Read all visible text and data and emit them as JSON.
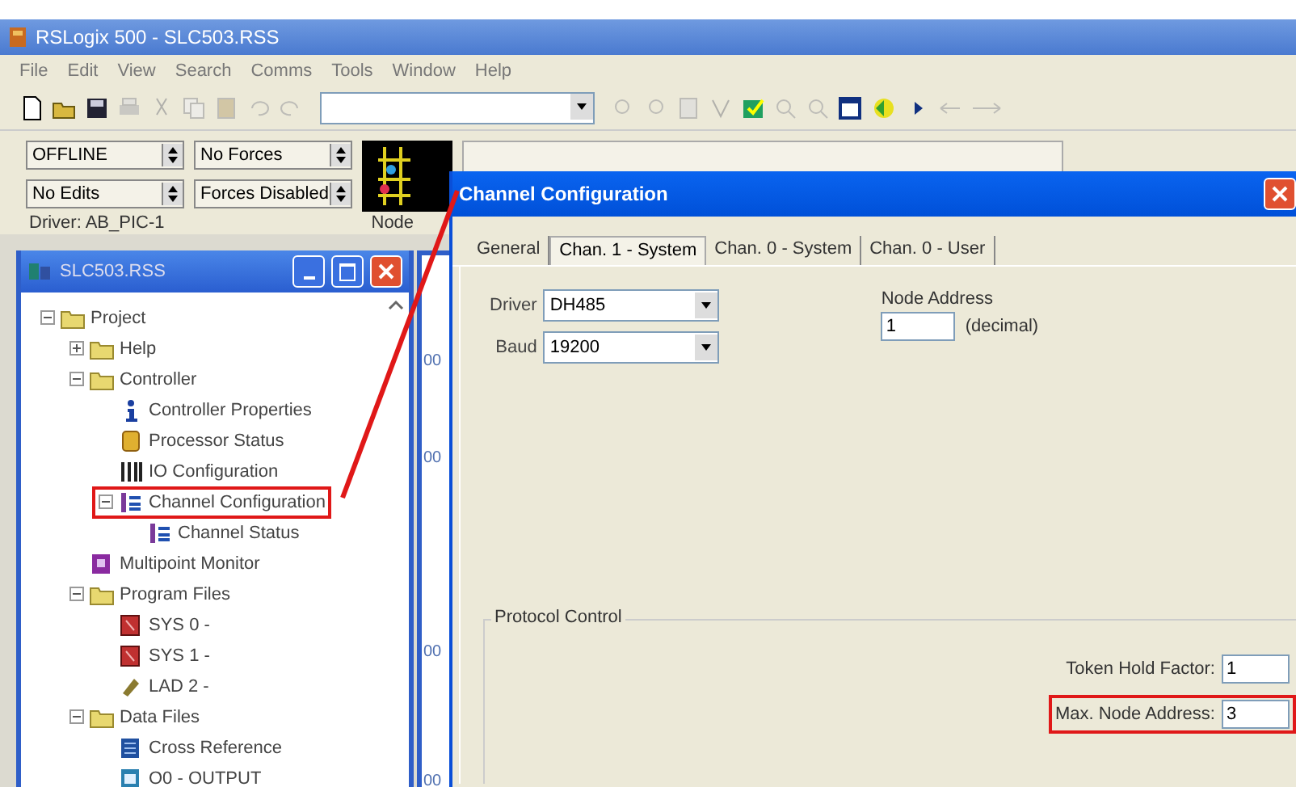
{
  "window": {
    "title": "RSLogix 500 - SLC503.RSS"
  },
  "menu": [
    "File",
    "Edit",
    "View",
    "Search",
    "Comms",
    "Tools",
    "Window",
    "Help"
  ],
  "status": {
    "mode": "OFFLINE",
    "forces": "No Forces",
    "edits": "No Edits",
    "forces_enabled": "Forces Disabled",
    "driver": "Driver: AB_PIC-1",
    "node": "Node"
  },
  "project_window": {
    "title": "SLC503.RSS",
    "tree": [
      {
        "label": "Project",
        "kind": "folder",
        "expanded": true,
        "highlighted": false,
        "children": [
          {
            "label": "Help",
            "kind": "folder",
            "expanded": false,
            "highlighted": false
          },
          {
            "label": "Controller",
            "kind": "folder",
            "expanded": true,
            "highlighted": false,
            "children": [
              {
                "label": "Controller Properties",
                "kind": "info",
                "highlighted": false
              },
              {
                "label": "Processor Status",
                "kind": "processor",
                "highlighted": false
              },
              {
                "label": "IO Configuration",
                "kind": "io",
                "highlighted": false
              },
              {
                "label": "Channel Configuration",
                "kind": "channel",
                "expanded": true,
                "highlighted": true,
                "children": [
                  {
                    "label": "Channel Status",
                    "kind": "channel",
                    "highlighted": false
                  }
                ]
              }
            ]
          },
          {
            "label": "Multipoint Monitor",
            "kind": "monitor",
            "highlighted": false
          },
          {
            "label": "Program Files",
            "kind": "folder",
            "expanded": true,
            "highlighted": false,
            "children": [
              {
                "label": "SYS 0 -",
                "kind": "program",
                "highlighted": false
              },
              {
                "label": "SYS 1 -",
                "kind": "program",
                "highlighted": false
              },
              {
                "label": "LAD 2 -",
                "kind": "ladder",
                "highlighted": false
              }
            ]
          },
          {
            "label": "Data Files",
            "kind": "folder",
            "expanded": true,
            "highlighted": false,
            "children": [
              {
                "label": "Cross Reference",
                "kind": "crossref",
                "highlighted": false
              },
              {
                "label": "O0 - OUTPUT",
                "kind": "datafile",
                "highlighted": false
              }
            ]
          }
        ]
      }
    ]
  },
  "ladder": {
    "rung_numbers": [
      "00",
      "00",
      "00",
      "00"
    ]
  },
  "dialog": {
    "title": "Channel Configuration",
    "tabs": [
      {
        "label": "General",
        "selected": false
      },
      {
        "label": "Chan. 1 - System",
        "selected": true
      },
      {
        "label": "Chan. 0 - System",
        "selected": false
      },
      {
        "label": "Chan. 0 - User",
        "selected": false
      }
    ],
    "driver": {
      "label": "Driver",
      "value": "DH485"
    },
    "baud": {
      "label": "Baud",
      "value": "19200"
    },
    "node_address": {
      "label": "Node Address",
      "value": "1",
      "unit": "(decimal)"
    },
    "protocol_control": {
      "title": "Protocol Control",
      "fields": [
        {
          "label": "Token Hold Factor:",
          "value": "1",
          "highlighted": false
        },
        {
          "label": "Max. Node Address:",
          "value": "3",
          "highlighted": true
        }
      ]
    }
  }
}
